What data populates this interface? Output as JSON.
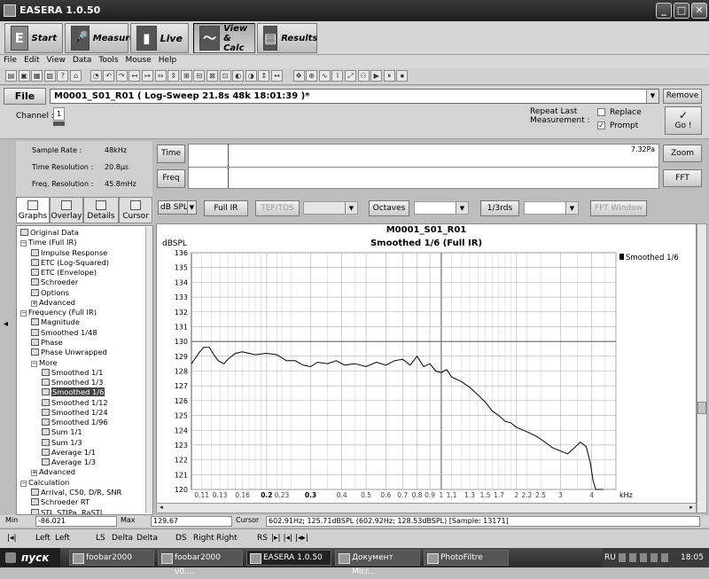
{
  "window": {
    "title": "EASERA 1.0.50"
  },
  "modes": [
    {
      "label": "Start",
      "icon": "E"
    },
    {
      "label": "Measure",
      "icon": "mic"
    },
    {
      "label": "Live",
      "icon": "bars"
    },
    {
      "label": "View & Calc",
      "icon": "wave"
    },
    {
      "label": "Results",
      "icon": "folder"
    }
  ],
  "mode_labels": {
    "start": "Start",
    "measure": "Measure",
    "live": "Live",
    "view1": "View",
    "view2": "& Calc",
    "results": "Results"
  },
  "menu": [
    "File",
    "Edit",
    "View",
    "Data",
    "Tools",
    "Mouse",
    "Help"
  ],
  "file": {
    "button": "File",
    "current": "M0001_S01_R01 ( Log-Sweep 21.8s 48k 18:01:39 )*",
    "remove": "Remove"
  },
  "channel": {
    "label": "Channel :",
    "value": "1"
  },
  "repeat": {
    "label1": "Repeat Last",
    "label2": "Measurement :",
    "replace": "Replace",
    "prompt": "Prompt",
    "go": "Go !",
    "go_icon": "✓"
  },
  "info": {
    "sample_rate_label": "Sample Rate :",
    "sample_rate": "48kHz",
    "time_res_label": "Time Resolution :",
    "time_res": "20.8µs",
    "freq_res_label": "Freq. Resolution :",
    "freq_res": "45.8mHz"
  },
  "timepanel": {
    "time_btn": "Time",
    "freq_btn": "Freq",
    "peak": "7.32Pa",
    "zoom": "Zoom",
    "fft": "FFT"
  },
  "tabs": [
    "Graphs",
    "Overlay",
    "Details",
    "Cursor"
  ],
  "plotbar": {
    "unit": "dB SPL",
    "full_ir": "Full IR",
    "tef": "TEF/TDS",
    "octaves": "Octaves",
    "thirds": "1/3rds",
    "fft_window": "FFT Window"
  },
  "tree": [
    {
      "label": "Original Data",
      "lvl": 0,
      "kind": "icon"
    },
    {
      "label": "Time (Full IR)",
      "lvl": 0,
      "kind": "minus"
    },
    {
      "label": "Impulse Response",
      "lvl": 1,
      "kind": "icon"
    },
    {
      "label": "ETC (Log-Squared)",
      "lvl": 1,
      "kind": "icon"
    },
    {
      "label": "ETC (Envelope)",
      "lvl": 1,
      "kind": "icon"
    },
    {
      "label": "Schroeder",
      "lvl": 1,
      "kind": "icon"
    },
    {
      "label": "Options",
      "lvl": 1,
      "kind": "icon"
    },
    {
      "label": "Advanced",
      "lvl": 1,
      "kind": "plus"
    },
    {
      "label": "Frequency (Full IR)",
      "lvl": 0,
      "kind": "minus"
    },
    {
      "label": "Magnitude",
      "lvl": 1,
      "kind": "icon"
    },
    {
      "label": "Smoothed 1/48",
      "lvl": 1,
      "kind": "icon"
    },
    {
      "label": "Phase",
      "lvl": 1,
      "kind": "icon"
    },
    {
      "label": "Phase Unwrapped",
      "lvl": 1,
      "kind": "icon"
    },
    {
      "label": "More",
      "lvl": 1,
      "kind": "minus"
    },
    {
      "label": "Smoothed 1/1",
      "lvl": 2,
      "kind": "icon"
    },
    {
      "label": "Smoothed 1/3",
      "lvl": 2,
      "kind": "icon"
    },
    {
      "label": "Smoothed 1/6",
      "lvl": 2,
      "kind": "icon",
      "selected": true
    },
    {
      "label": "Smoothed 1/12",
      "lvl": 2,
      "kind": "icon"
    },
    {
      "label": "Smoothed 1/24",
      "lvl": 2,
      "kind": "icon"
    },
    {
      "label": "Smoothed 1/96",
      "lvl": 2,
      "kind": "icon"
    },
    {
      "label": "Sum 1/1",
      "lvl": 2,
      "kind": "icon"
    },
    {
      "label": "Sum 1/3",
      "lvl": 2,
      "kind": "icon"
    },
    {
      "label": "Average 1/1",
      "lvl": 2,
      "kind": "icon"
    },
    {
      "label": "Average 1/3",
      "lvl": 2,
      "kind": "icon"
    },
    {
      "label": "Advanced",
      "lvl": 1,
      "kind": "plus"
    },
    {
      "label": "Calculation",
      "lvl": 0,
      "kind": "minus"
    },
    {
      "label": "Arrival, C50, D/R, SNR",
      "lvl": 1,
      "kind": "icon"
    },
    {
      "label": "Schroeder RT",
      "lvl": 1,
      "kind": "icon"
    },
    {
      "label": "STI, STIPa, RaSTI",
      "lvl": 1,
      "kind": "icon"
    }
  ],
  "chart_data": {
    "type": "line",
    "title": "M0001_S01_R01",
    "subtitle": "Smoothed 1/6 (Full IR)",
    "ylabel": "dBSPL",
    "xlabel": "kHz",
    "x_scale": "log",
    "ylim": [
      120,
      136
    ],
    "xlim_khz": [
      0.1,
      5
    ],
    "grid": true,
    "legend_position": "top-right",
    "yticks": [
      "136",
      "135",
      "134",
      "133",
      "132",
      "131",
      "130",
      "129",
      "128",
      "127",
      "126",
      "125",
      "124",
      "123",
      "122",
      "121",
      "120"
    ],
    "xticks": [
      {
        "v": 0.11,
        "t": "0.11"
      },
      {
        "v": 0.13,
        "t": "0.13"
      },
      {
        "v": 0.16,
        "t": "0.16"
      },
      {
        "v": 0.2,
        "t": "0.2"
      },
      {
        "v": 0.23,
        "t": "0.23"
      },
      {
        "v": 0.3,
        "t": "0.3"
      },
      {
        "v": 0.4,
        "t": "0.4"
      },
      {
        "v": 0.5,
        "t": "0.5"
      },
      {
        "v": 0.6,
        "t": "0.6"
      },
      {
        "v": 0.7,
        "t": "0.7"
      },
      {
        "v": 0.8,
        "t": "0.8"
      },
      {
        "v": 0.9,
        "t": "0.9"
      },
      {
        "v": 1,
        "t": "1"
      },
      {
        "v": 1.1,
        "t": "1.1"
      },
      {
        "v": 1.3,
        "t": "1.3"
      },
      {
        "v": 1.5,
        "t": "1.5"
      },
      {
        "v": 1.7,
        "t": "1.7"
      },
      {
        "v": 2,
        "t": "2"
      },
      {
        "v": 2.2,
        "t": "2.2"
      },
      {
        "v": 2.5,
        "t": "2.5"
      },
      {
        "v": 3,
        "t": "3"
      },
      {
        "v": 4,
        "t": "4"
      }
    ],
    "series": [
      {
        "name": "Smoothed 1/6",
        "color": "#000000",
        "x": [
          0.1,
          0.104,
          0.108,
          0.112,
          0.118,
          0.123,
          0.128,
          0.135,
          0.14,
          0.15,
          0.16,
          0.17,
          0.18,
          0.2,
          0.22,
          0.24,
          0.26,
          0.28,
          0.3,
          0.32,
          0.35,
          0.38,
          0.41,
          0.45,
          0.5,
          0.55,
          0.6,
          0.65,
          0.7,
          0.75,
          0.8,
          0.85,
          0.9,
          0.95,
          1.0,
          1.05,
          1.1,
          1.2,
          1.3,
          1.4,
          1.5,
          1.6,
          1.7,
          1.8,
          1.9,
          2.0,
          2.2,
          2.4,
          2.6,
          2.8,
          3.0,
          3.2,
          3.4,
          3.6,
          3.8,
          3.95,
          4.05,
          4.15,
          4.25,
          4.35,
          4.45
        ],
        "y": [
          128.5,
          128.9,
          129.3,
          129.6,
          129.6,
          129.1,
          128.7,
          128.5,
          128.8,
          129.2,
          129.3,
          129.2,
          129.1,
          129.2,
          129.1,
          128.7,
          128.7,
          128.4,
          128.3,
          128.6,
          128.5,
          128.7,
          128.4,
          128.5,
          128.3,
          128.6,
          128.4,
          128.7,
          128.8,
          128.4,
          129.0,
          128.3,
          128.5,
          128.0,
          127.9,
          128.1,
          127.6,
          127.3,
          126.9,
          126.4,
          125.9,
          125.3,
          125.0,
          124.6,
          124.5,
          124.2,
          123.9,
          123.6,
          123.2,
          122.8,
          122.6,
          122.4,
          122.8,
          123.2,
          122.9,
          121.8,
          120.6,
          120.0,
          120.0,
          120.0,
          120.0
        ]
      }
    ]
  },
  "status": {
    "min_label": "Min",
    "min": "-86.021",
    "max_label": "Max",
    "max": "129.67",
    "cursor_label": "Cursor",
    "cursor": "602.91Hz; 125.71dBSPL  (602.92Hz; 128.53dBSPL) [Sample: 13171]"
  },
  "bottom": {
    "i1": "Left",
    "i2": "Left",
    "ls": "LS",
    "d1": "Delta",
    "d2": "Delta",
    "ds": "DS",
    "r1": "Right",
    "r2": "Right",
    "rs": "RS"
  },
  "taskbar": {
    "start": "пуск",
    "tasks": [
      "foobar2000",
      "foobar2000 v0....",
      "EASERA 1.0.50",
      "Документ Micr...",
      "PhotoFiltre"
    ],
    "lang": "RU",
    "clock": "18:05"
  }
}
